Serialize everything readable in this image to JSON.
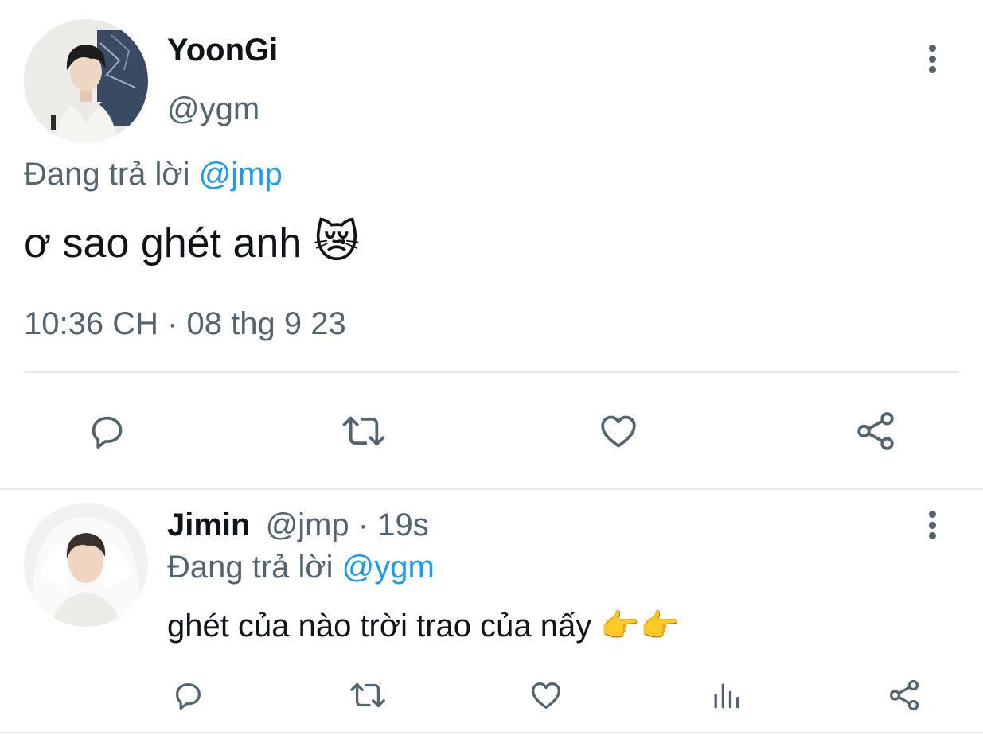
{
  "main_tweet": {
    "author_name": "YoonGi",
    "author_handle": "@ygm",
    "reply_prefix": "Đang trả lời",
    "reply_to": "@jmp",
    "text": "ơ sao ghét anh",
    "emoji": "😿",
    "timestamp": "10:36 CH · 08 thg 9 23",
    "actions": [
      "reply-icon",
      "retweet-icon",
      "like-icon",
      "share-icon"
    ]
  },
  "reply_tweet": {
    "author_name": "Jimin",
    "author_handle": "@jmp",
    "separator": "·",
    "time_ago": "19s",
    "reply_prefix": "Đang trả lời",
    "reply_to": "@ygm",
    "text": "ghét của nào trời trao của nấy",
    "emoji": "👉👉",
    "actions": [
      "reply-icon",
      "retweet-icon",
      "like-icon",
      "analytics-icon",
      "share-icon"
    ]
  },
  "colors": {
    "text_primary": "#0f1419",
    "text_secondary": "#536471",
    "link": "#1d9bf0",
    "divider": "#e6e9ec"
  }
}
